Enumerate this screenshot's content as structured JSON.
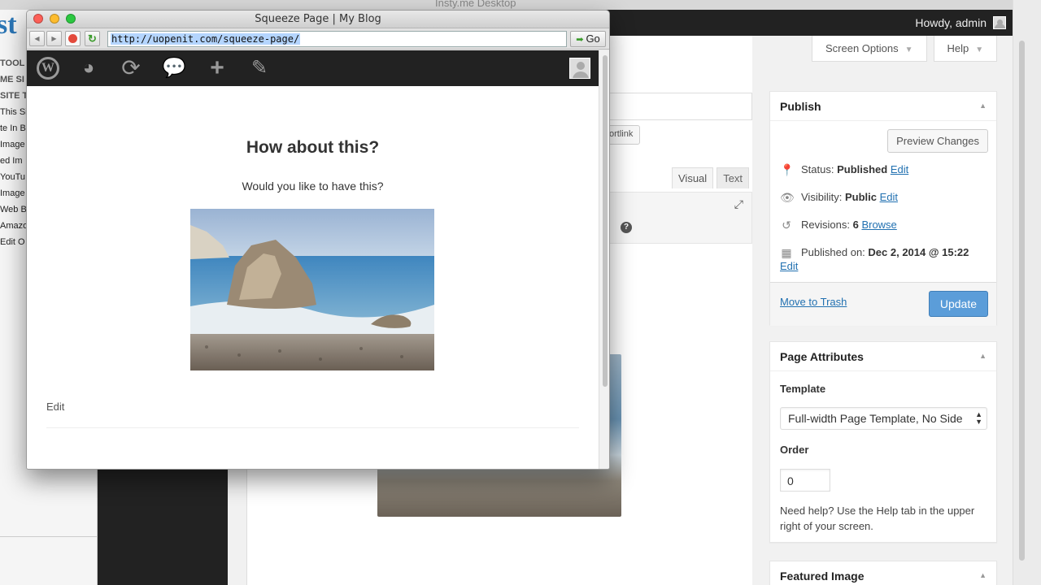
{
  "desktop": {
    "window_title": "Insty.me Desktop"
  },
  "insty_sidebar": {
    "logo": "st",
    "items": [
      "TOOL",
      "ME SI",
      "SITE T",
      "This Si",
      "te In B",
      "Image",
      "ed Im",
      "YouTu",
      "Image",
      "Web Br",
      "Amazo",
      "Edit O"
    ]
  },
  "wp_admin": {
    "howdy": "Howdy, admin",
    "screen_options": "Screen Options",
    "help": "Help",
    "shortlink": "ortlink",
    "tab_visual": "Visual",
    "tab_text": "Text",
    "publish": {
      "title": "Publish",
      "preview": "Preview Changes",
      "status_label": "Status: ",
      "status_value": "Published",
      "status_edit": "Edit",
      "visibility_label": "Visibility: ",
      "visibility_value": "Public",
      "visibility_edit": "Edit",
      "revisions_label": "Revisions: ",
      "revisions_value": "6",
      "revisions_browse": "Browse",
      "published_label": "Published on: ",
      "published_value": "Dec 2, 2014 @ 15:22",
      "published_edit": "Edit",
      "trash": "Move to Trash",
      "update": "Update"
    },
    "attributes": {
      "title": "Page Attributes",
      "template_label": "Template",
      "template_value": "Full-width Page Template, No Side",
      "order_label": "Order",
      "order_value": "0",
      "help": "Need help? Use the Help tab in the upper right of your screen."
    },
    "featured": {
      "title": "Featured Image"
    }
  },
  "browser": {
    "title": "Squeeze Page | My Blog",
    "url": "http://uopenit.com/squeeze-page/",
    "go": "Go",
    "page": {
      "heading": "How about this?",
      "subtext": "Would you like to have this?",
      "edit": "Edit"
    }
  }
}
